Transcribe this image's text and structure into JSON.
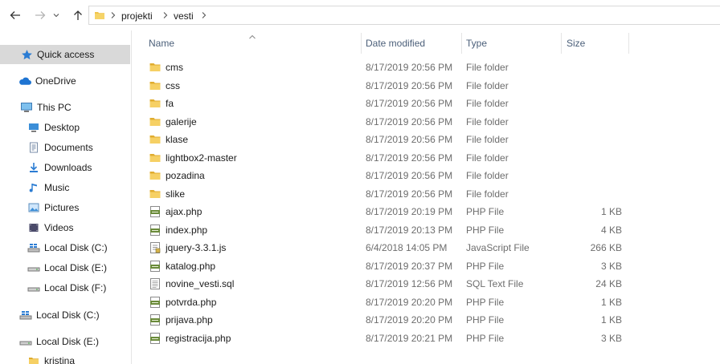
{
  "breadcrumb": [
    "projekti",
    "vesti"
  ],
  "columns": {
    "name": "Name",
    "date": "Date modified",
    "type": "Type",
    "size": "Size"
  },
  "sidebar": {
    "quick_access": "Quick access",
    "onedrive": "OneDrive",
    "this_pc": "This PC",
    "pc_items": [
      {
        "label": "Desktop",
        "icon": "desktop-icon"
      },
      {
        "label": "Documents",
        "icon": "documents-icon"
      },
      {
        "label": "Downloads",
        "icon": "downloads-icon"
      },
      {
        "label": "Music",
        "icon": "music-icon"
      },
      {
        "label": "Pictures",
        "icon": "pictures-icon"
      },
      {
        "label": "Videos",
        "icon": "videos-icon"
      },
      {
        "label": "Local Disk (C:)",
        "icon": "system-drive-icon"
      },
      {
        "label": "Local Disk (E:)",
        "icon": "drive-icon"
      },
      {
        "label": "Local Disk (F:)",
        "icon": "drive-icon"
      }
    ],
    "root_items": [
      {
        "label": "Local Disk (C:)",
        "icon": "system-drive-icon"
      },
      {
        "label": "Local Disk (E:)",
        "icon": "drive-icon"
      }
    ],
    "sub_items": [
      {
        "label": "kristina",
        "icon": "folder-icon"
      }
    ]
  },
  "files": [
    {
      "name": "cms",
      "date": "8/17/2019 20:56 PM",
      "type": "File folder",
      "size": "",
      "icon": "folder"
    },
    {
      "name": "css",
      "date": "8/17/2019 20:56 PM",
      "type": "File folder",
      "size": "",
      "icon": "folder"
    },
    {
      "name": "fa",
      "date": "8/17/2019 20:56 PM",
      "type": "File folder",
      "size": "",
      "icon": "folder"
    },
    {
      "name": "galerije",
      "date": "8/17/2019 20:56 PM",
      "type": "File folder",
      "size": "",
      "icon": "folder"
    },
    {
      "name": "klase",
      "date": "8/17/2019 20:56 PM",
      "type": "File folder",
      "size": "",
      "icon": "folder"
    },
    {
      "name": "lightbox2-master",
      "date": "8/17/2019 20:56 PM",
      "type": "File folder",
      "size": "",
      "icon": "folder"
    },
    {
      "name": "pozadina",
      "date": "8/17/2019 20:56 PM",
      "type": "File folder",
      "size": "",
      "icon": "folder"
    },
    {
      "name": "slike",
      "date": "8/17/2019 20:56 PM",
      "type": "File folder",
      "size": "",
      "icon": "folder"
    },
    {
      "name": "ajax.php",
      "date": "8/17/2019 20:19 PM",
      "type": "PHP File",
      "size": "1 KB",
      "icon": "php"
    },
    {
      "name": "index.php",
      "date": "8/17/2019 20:13 PM",
      "type": "PHP File",
      "size": "4 KB",
      "icon": "php"
    },
    {
      "name": "jquery-3.3.1.js",
      "date": "6/4/2018 14:05 PM",
      "type": "JavaScript File",
      "size": "266 KB",
      "icon": "js"
    },
    {
      "name": "katalog.php",
      "date": "8/17/2019 20:37 PM",
      "type": "PHP File",
      "size": "3 KB",
      "icon": "php"
    },
    {
      "name": "novine_vesti.sql",
      "date": "8/17/2019 12:56 PM",
      "type": "SQL Text File",
      "size": "24 KB",
      "icon": "sql"
    },
    {
      "name": "potvrda.php",
      "date": "8/17/2019 20:20 PM",
      "type": "PHP File",
      "size": "1 KB",
      "icon": "php"
    },
    {
      "name": "prijava.php",
      "date": "8/17/2019 20:20 PM",
      "type": "PHP File",
      "size": "1 KB",
      "icon": "php"
    },
    {
      "name": "registracija.php",
      "date": "8/17/2019 20:21 PM",
      "type": "PHP File",
      "size": "3 KB",
      "icon": "php"
    }
  ],
  "colors": {
    "folder": "#f0c44c",
    "selection": "#d9d9d9",
    "header_text": "#4c607a",
    "meta_text": "#6d6d6d",
    "onedrive": "#1e74d2"
  }
}
